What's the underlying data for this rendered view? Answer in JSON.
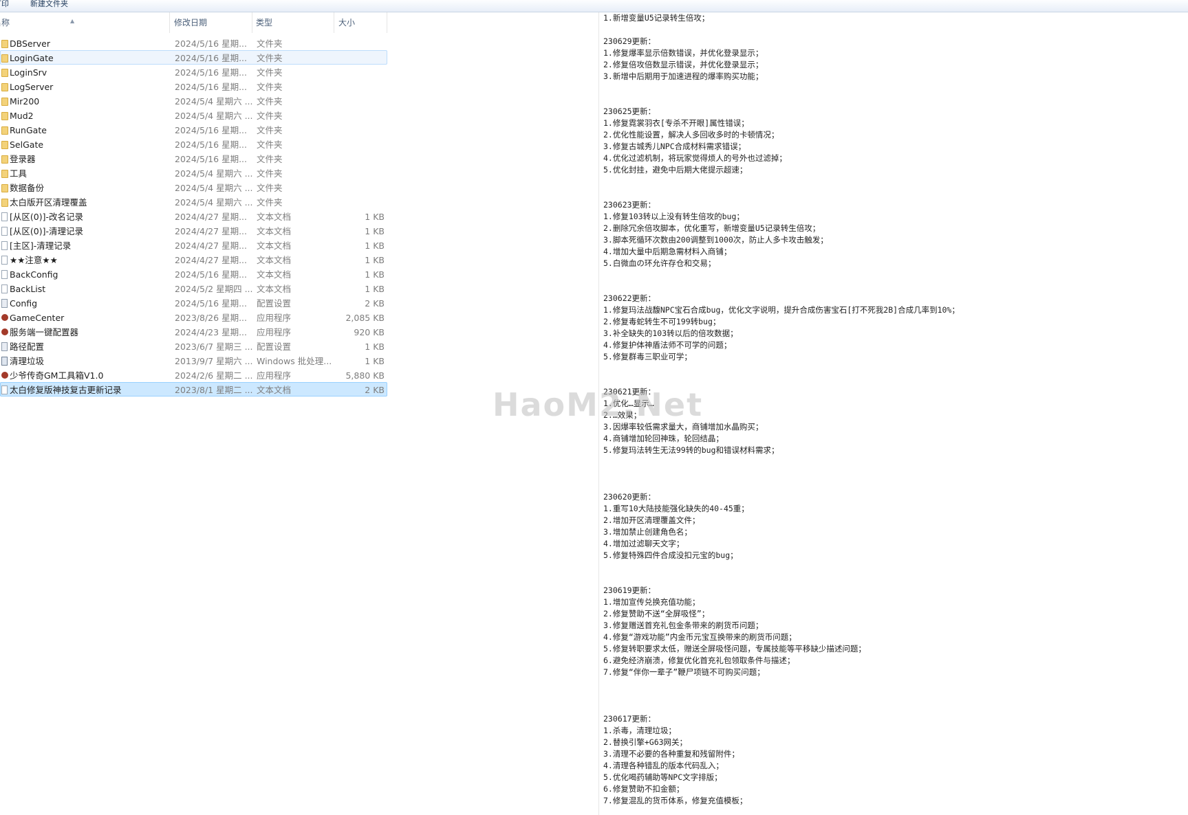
{
  "toolbar": {
    "item1": "打印",
    "item2": "新建文件夹"
  },
  "columns": {
    "name": "名称",
    "date": "修改日期",
    "type": "类型",
    "size": "大小"
  },
  "files": [
    {
      "name": "DBServer",
      "date": "2024/5/16 星期...",
      "type": "文件夹",
      "size": "",
      "icon": "folder-icon",
      "state": ""
    },
    {
      "name": "LoginGate",
      "date": "2024/5/16 星期...",
      "type": "文件夹",
      "size": "",
      "icon": "folder-icon",
      "state": "hover"
    },
    {
      "name": "LoginSrv",
      "date": "2024/5/16 星期...",
      "type": "文件夹",
      "size": "",
      "icon": "folder-icon",
      "state": ""
    },
    {
      "name": "LogServer",
      "date": "2024/5/16 星期...",
      "type": "文件夹",
      "size": "",
      "icon": "folder-icon",
      "state": ""
    },
    {
      "name": "Mir200",
      "date": "2024/5/4 星期六 ...",
      "type": "文件夹",
      "size": "",
      "icon": "folder-icon",
      "state": ""
    },
    {
      "name": "Mud2",
      "date": "2024/5/4 星期六 ...",
      "type": "文件夹",
      "size": "",
      "icon": "folder-icon",
      "state": ""
    },
    {
      "name": "RunGate",
      "date": "2024/5/16 星期...",
      "type": "文件夹",
      "size": "",
      "icon": "folder-icon",
      "state": ""
    },
    {
      "name": "SelGate",
      "date": "2024/5/16 星期...",
      "type": "文件夹",
      "size": "",
      "icon": "folder-icon",
      "state": ""
    },
    {
      "name": "登录器",
      "date": "2024/5/16 星期...",
      "type": "文件夹",
      "size": "",
      "icon": "folder-icon",
      "state": ""
    },
    {
      "name": "工具",
      "date": "2024/5/4 星期六 ...",
      "type": "文件夹",
      "size": "",
      "icon": "folder-icon",
      "state": ""
    },
    {
      "name": "数据备份",
      "date": "2024/5/4 星期六 ...",
      "type": "文件夹",
      "size": "",
      "icon": "folder-icon",
      "state": ""
    },
    {
      "name": "太白版开区清理覆盖",
      "date": "2024/5/4 星期六 ...",
      "type": "文件夹",
      "size": "",
      "icon": "folder-icon",
      "state": ""
    },
    {
      "name": "[从区(0)]-改名记录",
      "date": "2024/4/27 星期...",
      "type": "文本文档",
      "size": "1 KB",
      "icon": "text-document-icon",
      "state": ""
    },
    {
      "name": "[从区(0)]-清理记录",
      "date": "2024/4/27 星期...",
      "type": "文本文档",
      "size": "1 KB",
      "icon": "text-document-icon",
      "state": ""
    },
    {
      "name": "[主区]-清理记录",
      "date": "2024/4/27 星期...",
      "type": "文本文档",
      "size": "1 KB",
      "icon": "text-document-icon",
      "state": ""
    },
    {
      "name": "★★注意★★",
      "date": "2024/4/27 星期...",
      "type": "文本文档",
      "size": "1 KB",
      "icon": "text-document-icon",
      "state": ""
    },
    {
      "name": "BackConfig",
      "date": "2024/5/16 星期...",
      "type": "文本文档",
      "size": "1 KB",
      "icon": "text-document-icon",
      "state": ""
    },
    {
      "name": "BackList",
      "date": "2024/5/2 星期四 ...",
      "type": "文本文档",
      "size": "1 KB",
      "icon": "text-document-icon",
      "state": ""
    },
    {
      "name": "Config",
      "date": "2024/5/16 星期...",
      "type": "配置设置",
      "size": "2 KB",
      "icon": "config-file-icon",
      "state": ""
    },
    {
      "name": "GameCenter",
      "date": "2023/8/26 星期...",
      "type": "应用程序",
      "size": "2,085 KB",
      "icon": "app-icon",
      "state": ""
    },
    {
      "name": "服务端一键配置器",
      "date": "2024/4/23 星期...",
      "type": "应用程序",
      "size": "920 KB",
      "icon": "app-icon",
      "state": ""
    },
    {
      "name": "路径配置",
      "date": "2023/6/7 星期三 ...",
      "type": "配置设置",
      "size": "1 KB",
      "icon": "config-file-icon",
      "state": ""
    },
    {
      "name": "清理垃圾",
      "date": "2013/9/7 星期六 ...",
      "type": "Windows 批处理...",
      "size": "1 KB",
      "icon": "batch-file-icon",
      "state": ""
    },
    {
      "name": "少爷传奇GM工具箱V1.0",
      "date": "2024/2/6 星期二 ...",
      "type": "应用程序",
      "size": "5,880 KB",
      "icon": "app-icon",
      "state": ""
    },
    {
      "name": "太白修复版神技复古更新记录",
      "date": "2023/8/1 星期二 ...",
      "type": "文本文档",
      "size": "2 KB",
      "icon": "text-document-icon",
      "state": "selected"
    }
  ],
  "log": {
    "text": "1.新增变量U5记录转生倍攻；\n\n230629更新：\n1.修复爆率显示倍数错误，并优化登录显示；\n2.修复倍攻倍数显示错误，并优化登录显示；\n3.新增中后期用于加速进程的爆率购买功能；\n\n\n230625更新：\n1.修复霓裳羽衣[专杀不开眼]属性错误；\n2.优化性能设置，解决人多回收多时的卡顿情况；\n3.修复古城秀儿NPC合成材料需求错误；\n4.优化过滤机制，将玩家觉得烦人的号外也过滤掉；\n5.优化封挂，避免中后期大佬提示超速；\n\n\n230623更新：\n1.修复103转以上没有转生倍攻的bug；\n2.删除冗余倍攻脚本，优化重写，新增变量U5记录转生倍攻；\n3.脚本死循环次数由200调整到1000次，防止人多卡攻击触发；\n4.增加大量中后期急需材料入商铺；\n5.白微血の环允许存仓和交易；\n\n\n230622更新：\n1.修复玛法战馥NPC宝石合成bug，优化文字说明，提升合成伤害宝石[打不死我2B]合成几率到10%；\n2.修复毒蛇转生不可199转bug；\n3.补全缺失的103转以后的倍攻数据；\n4.修复护体神盾法师不可学的问题；\n5.修复群毒三职业可学；\n\n\n230621更新：\n1.优化…显示…\n2.…效果；\n3.因爆率较低需求量大，商铺增加水晶购买；\n4.商铺增加轮回神珠，轮回结晶；\n5.修复玛法转生无法99转的bug和错误材料需求；\n\n\n\n230620更新：\n1.重写10大陆技能强化缺失的40-45重；\n2.增加开区清理覆盖文件；\n3.增加禁止创建角色名；\n4.增加过滤聊天文字；\n5.修复特殊四件合成没扣元宝的bug；\n\n\n230619更新：\n1.增加宣传兑换充值功能；\n2.修复赞助不送“全屏吸怪”；\n3.修复赠送首充礼包金条带来的刷货币问题；\n4.修复“游戏功能”内金币元宝互换带来的刷货币问题；\n5.修复转职要求太低，赠送全屏吸怪问题，专属技能等平移缺少描述问题；\n6.避免经济崩溃，修复优化首充礼包领取条件与描述；\n7.修复“伴你一辈子”鞭尸项链不可购买问题；\n\n\n\n230617更新：\n1.杀毒，清理垃圾；\n2.替换引擎+G63网关；\n3.清理不必要的各种重复和残留附件；\n4.清理各种错乱的版本代码乱入；\n5.优化喝药辅助等NPC文字排版；\n6.修复赞助不扣金额；\n7.修复混乱的货币体系，修复充值模板；"
  },
  "watermark": "HaoM2.Net"
}
